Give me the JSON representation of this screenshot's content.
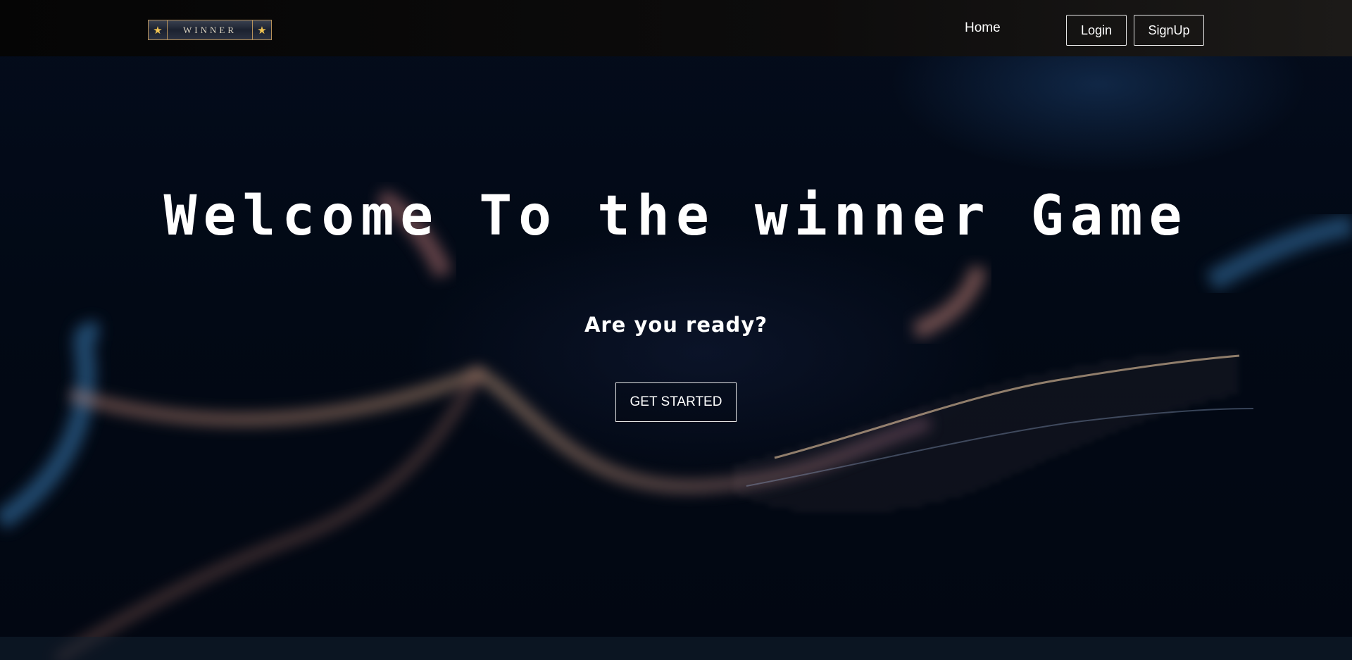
{
  "nav": {
    "logo_text": "WINNER",
    "logo_star": "★",
    "home_label": "Home",
    "login_label": "Login",
    "signup_label": "SignUp"
  },
  "hero": {
    "title": "Welcome To the winner Game",
    "subtitle": "Are you ready?",
    "cta_label": "GET STARTED"
  },
  "colors": {
    "background": "#020814",
    "navbar": "#0d0c0c",
    "text": "#ffffff",
    "logo_border": "#b8925a",
    "logo_star": "#f2c452"
  }
}
